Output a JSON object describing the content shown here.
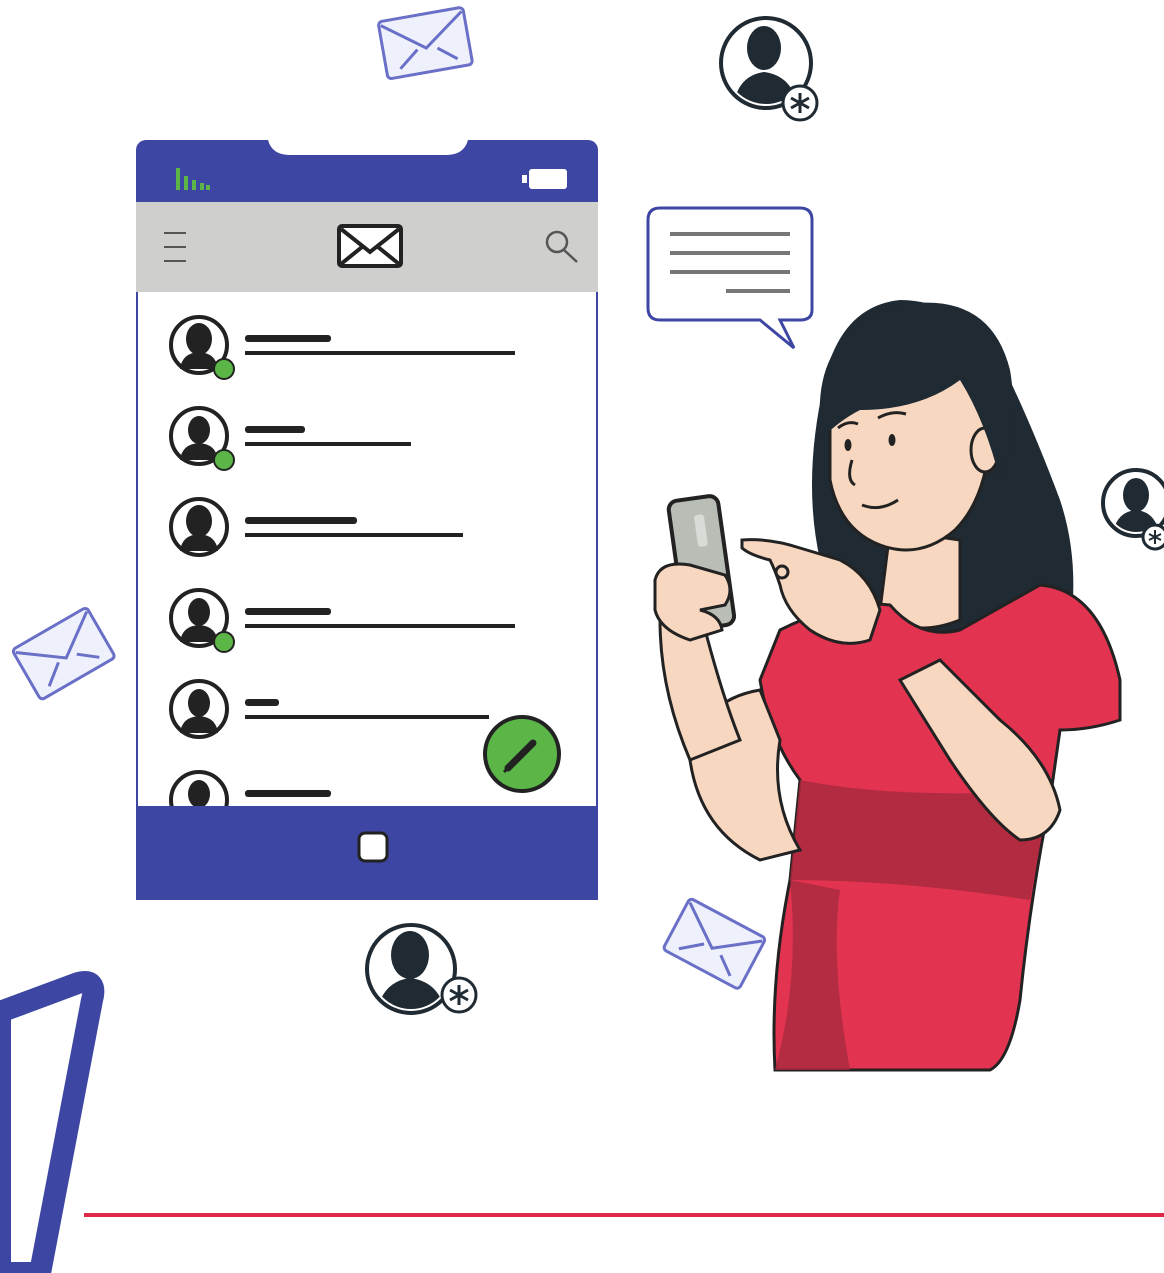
{
  "colors": {
    "brand_blue": "#3d47a3",
    "toolbar_gray": "#cfcfcd",
    "online_green": "#5bb647",
    "accent_red": "#e0284a",
    "shirt_red": "#e23350",
    "shirt_shadow": "#a92a3d",
    "skin": "#f8d7c0",
    "hair": "#1f2a33",
    "ink": "#222222",
    "envelope_stroke": "#6a70c7",
    "envelope_fill": "#eef0fb"
  },
  "icons": {
    "signal": "signal-icon",
    "battery": "battery-icon",
    "menu": "hamburger-menu-icon",
    "mail": "mail-icon",
    "search": "search-icon",
    "compose": "pencil-icon",
    "home": "home-button-icon"
  },
  "inbox": {
    "rows": [
      {
        "online": true,
        "gender": "female"
      },
      {
        "online": true,
        "gender": "male"
      },
      {
        "online": false,
        "gender": "female"
      },
      {
        "online": true,
        "gender": "male"
      },
      {
        "online": false,
        "gender": "male"
      },
      {
        "online": false,
        "gender": "male"
      }
    ]
  }
}
